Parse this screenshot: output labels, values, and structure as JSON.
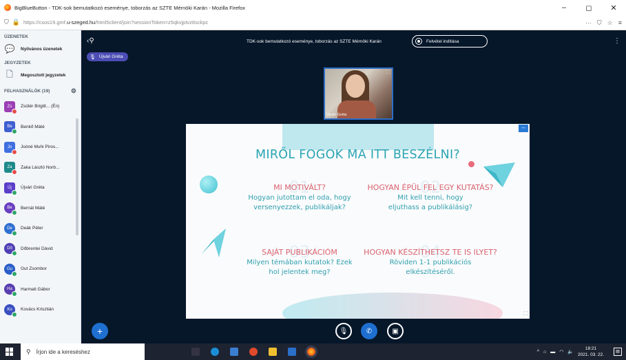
{
  "window": {
    "title": "BigBlueButton - TDK-sok bemutatkozó eseménye, toborzás az SZTE Mérnöki Karán - Mozilla Firefox",
    "url_prefix": "https://csos19.gmf.",
    "url_domain": "u-szeged.hu",
    "url_path": "/html5client/join?sessionToken=z5qkvjptvz8sckpc"
  },
  "sidebar": {
    "messages_title": "ÜZENETEK",
    "public_chat": "Nyilvános üzenetek",
    "notes_title": "JEGYZETEK",
    "shared_notes": "Megosztott jegyzetek",
    "users_title": "FELHASZNÁLÓK (19)",
    "users": [
      {
        "initials": "Zs",
        "name": "Zsótér Brigitt... (Én)",
        "color": "#9b3fb5",
        "status": "#e74c4c",
        "round": false
      },
      {
        "initials": "Be",
        "name": "Benkő Máté",
        "color": "#3f5fd1",
        "status": "#2fa66a",
        "round": false
      },
      {
        "initials": "Jo",
        "name": "Joóné Muhi Piros...",
        "color": "#3f6fe0",
        "status": "#e74c4c",
        "round": false
      },
      {
        "initials": "Za",
        "name": "Zaka László Norb...",
        "color": "#1e8a8a",
        "status": "#e74c4c",
        "round": false
      },
      {
        "initials": "Új",
        "name": "Újvári Gréta",
        "color": "#5b3fc9",
        "status": "#2fa66a",
        "round": false
      },
      {
        "initials": "Be",
        "name": "Bernát Máté",
        "color": "#6a3fc0",
        "status": "#2fa66a",
        "round": true
      },
      {
        "initials": "De",
        "name": "Deák Péter",
        "color": "#2f6fd0",
        "status": "#2fa66a",
        "round": true
      },
      {
        "initials": "Dő",
        "name": "Dőbrentei Dávid",
        "color": "#4f3fb5",
        "status": "#2fa66a",
        "round": true
      },
      {
        "initials": "Gu",
        "name": "Gut Zsombor",
        "color": "#2a5fc9",
        "status": "#2fa66a",
        "round": true
      },
      {
        "initials": "Ha",
        "name": "Harmati Gábor",
        "color": "#5a3fb0",
        "status": "#2fa66a",
        "round": true
      },
      {
        "initials": "Ko",
        "name": "Kovács Krisztián",
        "color": "#3a4fc0",
        "status": "#2fa66a",
        "round": true
      }
    ]
  },
  "main": {
    "meeting_title": "TDK-sok bemutatkozó eseménye, toborzás az SZTE Mérnöki Karán",
    "record_label": "Felvétel indítása",
    "presenter": "Újvári Gréta",
    "webcam_name": "Újvári Gréta"
  },
  "slide": {
    "heading": "MIRŐL FOGOK MA ITT BESZÉLNI?",
    "items": [
      {
        "num": "01",
        "title": "MI MOTIVÁLT?",
        "text": "Hogyan jutottam el oda, hogy versenyezzek, publikáljak?"
      },
      {
        "num": "02",
        "title": "HOGYAN ÉPÜL FEL EGY KUTATÁS?",
        "text": "Mit kell tenni, hogy eljuthass a publikálásig?"
      },
      {
        "num": "03",
        "title": "SAJÁT PUBLIKÁCIÓM",
        "text": "Milyen témában kutatok? Ezek hol jelentek meg?"
      },
      {
        "num": "04",
        "title": "HOGYAN KÉSZÍTHETSZ TE IS ILYET?",
        "text": "Röviden 1-1 publikációs elkészítéséről."
      }
    ]
  },
  "taskbar": {
    "search_placeholder": "Írjon ide a kereséshez",
    "time": "18:21",
    "date": "2021. 03. 22."
  },
  "colors": {
    "accent": "#1e6fd0",
    "slide_heading": "#2aa4b2",
    "slide_title": "#d9616e"
  }
}
